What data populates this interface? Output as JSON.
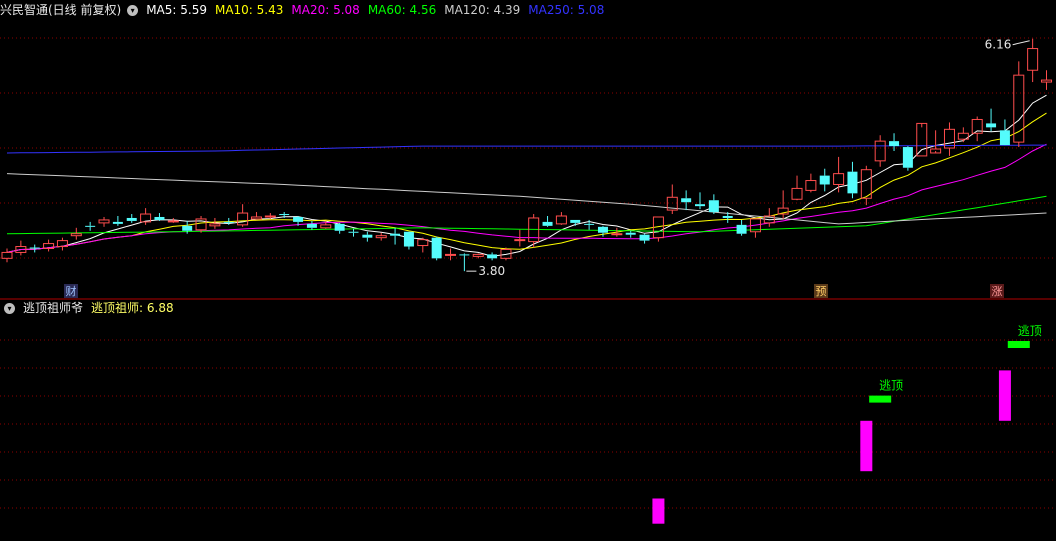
{
  "header": {
    "stock_title": "兴民智通(日线 前复权)",
    "ma_labels": [
      {
        "text": "MA5: 5.59",
        "color": "#ffffff"
      },
      {
        "text": "MA10: 5.43",
        "color": "#ffff00"
      },
      {
        "text": "MA20: 5.08",
        "color": "#ff00ff"
      },
      {
        "text": "MA60: 4.56",
        "color": "#00ff00"
      },
      {
        "text": "MA120: 4.39",
        "color": "#cccccc"
      },
      {
        "text": "MA250: 5.08",
        "color": "#3333ff"
      }
    ]
  },
  "indicator_header": {
    "name": "逃顶祖师爷",
    "value_label": "逃顶祖师: 6.88",
    "value_color": "#ffff66"
  },
  "markers": {
    "cai": "财",
    "yu": "预",
    "zhang": "涨"
  },
  "colors": {
    "up": "#ff4d4d",
    "down": "#54fcfc",
    "grid": "#8b0000",
    "signal": "#00ff00",
    "bar": "#ff00ff"
  },
  "chart_data": {
    "type": "candlestick",
    "y_range": [
      3.7,
      6.35
    ],
    "high_label": "6.16",
    "low_label": "3.80",
    "candles": [
      [
        3.93,
        3.99,
        4.03,
        3.89
      ],
      [
        3.99,
        4.05,
        4.11,
        3.96
      ],
      [
        4.04,
        4.03,
        4.07,
        3.99
      ],
      [
        4.03,
        4.08,
        4.12,
        4.0
      ],
      [
        4.05,
        4.11,
        4.14,
        4.01
      ],
      [
        4.16,
        4.18,
        4.24,
        4.12
      ],
      [
        4.26,
        4.25,
        4.3,
        4.21
      ],
      [
        4.29,
        4.32,
        4.35,
        4.25
      ],
      [
        4.3,
        4.28,
        4.36,
        4.26
      ],
      [
        4.34,
        4.31,
        4.38,
        4.29
      ],
      [
        4.3,
        4.38,
        4.44,
        4.27
      ],
      [
        4.35,
        4.32,
        4.39,
        4.31
      ],
      [
        4.3,
        4.31,
        4.34,
        4.29
      ],
      [
        4.26,
        4.21,
        4.31,
        4.18
      ],
      [
        4.22,
        4.33,
        4.36,
        4.19
      ],
      [
        4.26,
        4.28,
        4.34,
        4.23
      ],
      [
        4.3,
        4.29,
        4.34,
        4.27
      ],
      [
        4.27,
        4.39,
        4.48,
        4.25
      ],
      [
        4.33,
        4.35,
        4.4,
        4.33
      ],
      [
        4.35,
        4.36,
        4.39,
        4.33
      ],
      [
        4.38,
        4.37,
        4.4,
        4.34
      ],
      [
        4.35,
        4.3,
        4.36,
        4.26
      ],
      [
        4.28,
        4.24,
        4.31,
        4.22
      ],
      [
        4.24,
        4.27,
        4.31,
        4.23
      ],
      [
        4.28,
        4.21,
        4.29,
        4.18
      ],
      [
        4.2,
        4.19,
        4.23,
        4.15
      ],
      [
        4.17,
        4.14,
        4.2,
        4.1
      ],
      [
        4.14,
        4.16,
        4.19,
        4.11
      ],
      [
        4.18,
        4.16,
        4.24,
        4.07
      ],
      [
        4.2,
        4.05,
        4.2,
        4.02
      ],
      [
        4.06,
        4.12,
        4.14,
        3.99
      ],
      [
        4.14,
        3.93,
        4.15,
        3.91
      ],
      [
        3.96,
        3.97,
        4.03,
        3.91
      ],
      [
        3.97,
        3.96,
        3.98,
        3.8
      ],
      [
        3.95,
        3.97,
        3.98,
        3.93
      ],
      [
        3.97,
        3.93,
        3.99,
        3.91
      ],
      [
        3.93,
        4.02,
        4.04,
        3.91
      ],
      [
        4.12,
        4.12,
        4.22,
        4.05
      ],
      [
        4.1,
        4.34,
        4.38,
        4.04
      ],
      [
        4.3,
        4.26,
        4.36,
        4.25
      ],
      [
        4.28,
        4.36,
        4.4,
        4.27
      ],
      [
        4.32,
        4.29,
        4.32,
        4.26
      ],
      [
        4.28,
        4.27,
        4.32,
        4.22
      ],
      [
        4.25,
        4.19,
        4.26,
        4.15
      ],
      [
        4.17,
        4.18,
        4.24,
        4.15
      ],
      [
        4.19,
        4.17,
        4.21,
        4.14
      ],
      [
        4.17,
        4.11,
        4.18,
        4.08
      ],
      [
        4.14,
        4.35,
        4.35,
        4.1
      ],
      [
        4.42,
        4.55,
        4.68,
        4.38
      ],
      [
        4.54,
        4.5,
        4.62,
        4.42
      ],
      [
        4.48,
        4.46,
        4.6,
        4.43
      ],
      [
        4.52,
        4.4,
        4.58,
        4.38
      ],
      [
        4.36,
        4.34,
        4.4,
        4.29
      ],
      [
        4.27,
        4.18,
        4.32,
        4.16
      ],
      [
        4.2,
        4.33,
        4.33,
        4.14
      ],
      [
        4.29,
        4.36,
        4.44,
        4.25
      ],
      [
        4.38,
        4.44,
        4.62,
        4.33
      ],
      [
        4.53,
        4.64,
        4.77,
        4.52
      ],
      [
        4.62,
        4.72,
        4.79,
        4.6
      ],
      [
        4.77,
        4.68,
        4.84,
        4.61
      ],
      [
        4.68,
        4.79,
        4.96,
        4.6
      ],
      [
        4.81,
        4.59,
        4.91,
        4.54
      ],
      [
        4.54,
        4.83,
        4.87,
        4.47
      ],
      [
        4.92,
        5.12,
        5.18,
        4.86
      ],
      [
        5.12,
        5.07,
        5.2,
        5.02
      ],
      [
        5.06,
        4.85,
        5.07,
        4.82
      ],
      [
        4.97,
        5.3,
        5.26,
        4.97
      ],
      [
        5.0,
        5.04,
        5.23,
        5.02
      ],
      [
        5.05,
        5.24,
        5.31,
        4.97
      ],
      [
        5.14,
        5.2,
        5.26,
        5.11
      ],
      [
        5.2,
        5.34,
        5.37,
        5.12
      ],
      [
        5.3,
        5.26,
        5.45,
        5.22
      ],
      [
        5.23,
        5.08,
        5.34,
        5.09
      ],
      [
        5.11,
        5.79,
        5.93,
        5.06
      ],
      [
        5.84,
        6.06,
        6.16,
        5.72
      ],
      [
        5.72,
        5.74,
        5.84,
        5.64
      ]
    ],
    "ma_series": [
      {
        "name": "MA5",
        "color": "#ffffff"
      },
      {
        "name": "MA10",
        "color": "#ffff00"
      },
      {
        "name": "MA20",
        "color": "#ff00ff"
      },
      {
        "name": "MA60",
        "color": "#00ff00"
      },
      {
        "name": "MA120",
        "color": "#cccccc"
      },
      {
        "name": "MA250",
        "color": "#3333ff"
      }
    ],
    "indicator": {
      "y_range": [
        0,
        1
      ],
      "bars": [
        {
          "index": 47,
          "from": 0.03,
          "to": 0.15
        },
        {
          "index": 62,
          "from": 0.28,
          "to": 0.52
        },
        {
          "index": 72,
          "from": 0.52,
          "to": 0.76
        }
      ],
      "signals": [
        {
          "index": 63,
          "level": 0.64,
          "label": "逃顶"
        },
        {
          "index": 73,
          "level": 0.9,
          "label": "逃顶"
        }
      ]
    }
  }
}
